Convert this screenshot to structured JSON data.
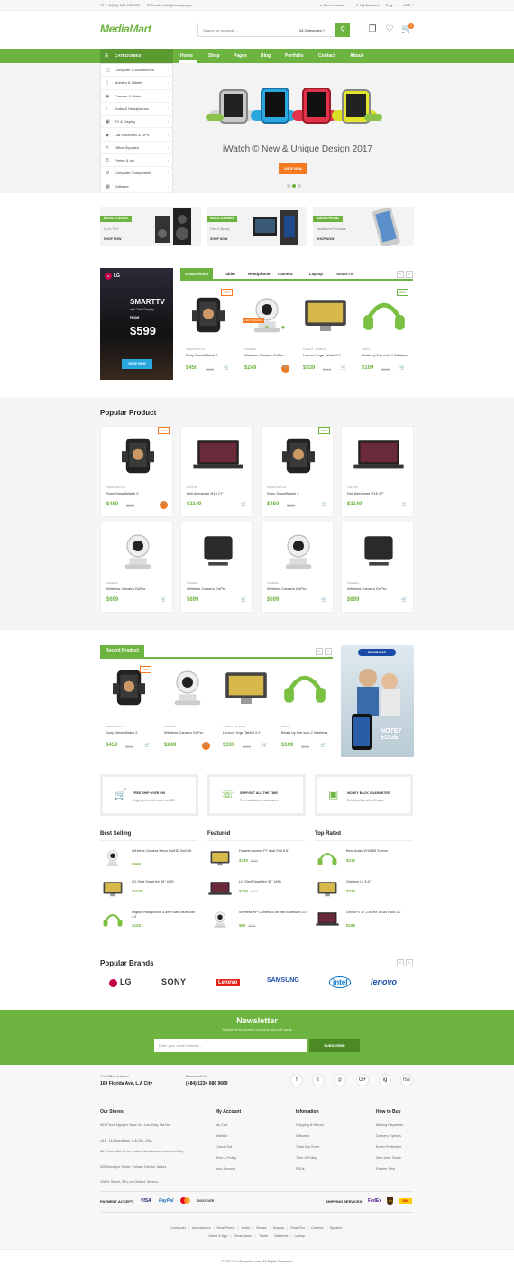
{
  "topbar": {
    "phone": "(+84)(0) 123 456 789",
    "email": "Email: hello@company.co",
    "store_locator": "Store Locator",
    "my_account": "My Account",
    "lang": "Eng",
    "currency": "USD"
  },
  "header": {
    "logo": "MediaMart",
    "search_placeholder": "Search for products ...",
    "search_category": "All Categories",
    "cart_count": "0"
  },
  "nav": {
    "categories_label": "CATEGORIES",
    "items": [
      "Home",
      "Shop",
      "Pages",
      "Blog",
      "Portfolio",
      "Contact",
      "About"
    ]
  },
  "categories": [
    "Computer & Accessories",
    "Mobiles & Tablets",
    "Camera & Video",
    "Audio & Headphones",
    "TV & Display",
    "Car Electronic & GPS",
    "Office Supplies",
    "Printer & Ink",
    "Computer Components",
    "Software"
  ],
  "hero": {
    "title": "iWatch © New & Unique Design 2017",
    "button": "SHOP NOW"
  },
  "banners": [
    {
      "tag": "MUSIC & AUDIO",
      "line": "Up to 70%",
      "link": "SHOP NOW"
    },
    {
      "tag": "BUILD GAMING",
      "line": "Fast & Strong",
      "link": "SHOP NOW"
    },
    {
      "tag": "SMARTPHONE",
      "line": "Installment Purchase",
      "link": "SHOP NOW"
    }
  ],
  "promo": {
    "brand": "LG",
    "title": "SMARTTV",
    "subtitle": "with Oled Display",
    "from": "FROM",
    "price": "$599",
    "button": "SHOP NOW"
  },
  "tabs": [
    "Smartphone",
    "Tablet",
    "Headphone",
    "Camera",
    "Laptop",
    "SmartTV"
  ],
  "tab_products": [
    {
      "type": "SMARTWATCH",
      "name": "Sony SmartWatch 2",
      "price": "$450",
      "old": "$550",
      "badge": "-40%"
    },
    {
      "type": "CAMERA",
      "name": "Wireless Camera GoPro",
      "price": "$249",
      "old": "",
      "badge": "",
      "hover": "Add to Wishlist"
    },
    {
      "type": "TABLET - MOBILE",
      "name": "Lenovo Yoga Tablet 2.0",
      "price": "$339",
      "old": "$419",
      "badge": ""
    },
    {
      "type": "AUDIO",
      "name": "Beats by Dre solo 2 Wireless",
      "price": "$109",
      "old": "$280",
      "badge": "NEW"
    }
  ],
  "popular": {
    "title": "Popular Product",
    "items": [
      {
        "type": "SMARTWATCH",
        "name": "Sony SmartWatch 2",
        "price": "$450",
        "old": "$550",
        "badge": "-40%"
      },
      {
        "type": "LAPTOP",
        "name": "Dell Alienware R15 17\"",
        "price": "$1149",
        "old": "",
        "badge": ""
      },
      {
        "type": "SMARTWATCH",
        "name": "Sony SmartWatch 2",
        "price": "$450",
        "old": "$550",
        "badge": "NEW"
      },
      {
        "type": "LAPTOP",
        "name": "Dell Alienware R15 17\"",
        "price": "$1149",
        "old": "",
        "badge": ""
      },
      {
        "type": "CAMERA",
        "name": "Wireless Camera GoPro",
        "price": "$699",
        "old": "",
        "badge": ""
      },
      {
        "type": "CAMERA",
        "name": "Wireless Camera GoPro",
        "price": "$699",
        "old": "",
        "badge": ""
      },
      {
        "type": "CAMERA",
        "name": "Wireless Camera GoPro",
        "price": "$699",
        "old": "",
        "badge": ""
      },
      {
        "type": "CAMERA",
        "name": "Wireless Camera GoPro",
        "price": "$699",
        "old": "",
        "badge": ""
      }
    ]
  },
  "recent": {
    "title": "Recent Product",
    "items": [
      {
        "type": "SMARTWATCH",
        "name": "Sony SmartWatch 2",
        "price": "$450",
        "old": "$550",
        "badge": "-40%"
      },
      {
        "type": "CAMERA",
        "name": "Wireless Camera GoPro",
        "price": "$249",
        "old": "",
        "badge": ""
      },
      {
        "type": "TABLET - MOBILE",
        "name": "Lenovo Yoga Tablet 2.0",
        "price": "$339",
        "old": "$419",
        "badge": ""
      },
      {
        "type": "AUDIO",
        "name": "Beats by Dre solo 2 Wireless",
        "price": "$109",
        "old": "$280",
        "badge": ""
      }
    ],
    "ad_brand": "SAMSUNG",
    "ad_text": "NOTE7 EDGE"
  },
  "services": [
    {
      "title": "FREE SHIP OVER $99",
      "sub": "Shipping free with order over $99"
    },
    {
      "title": "SUPPORT ALL THE TIME",
      "sub": "Free installation, maintenance"
    },
    {
      "title": "MONEY BACK GUARANTEE",
      "sub": "Refund policy within 30 days"
    }
  ],
  "lists": [
    {
      "title": "Best Selling",
      "items": [
        {
          "name": "Wireless Camera Xiono FullHD 3m/10ft",
          "price": "$565",
          "old": ""
        },
        {
          "name": "LG Oled Smart tivi 55\" UHD",
          "price": "$1149",
          "old": ""
        },
        {
          "name": "Orginal Headphone 3.5mm with bluetooth 3.0",
          "price": "$125",
          "old": ""
        }
      ]
    },
    {
      "title": "Featured",
      "items": [
        {
          "name": "Huawei Ascend P7 dual SIM 5.5\"",
          "price": "$330",
          "old": "$430"
        },
        {
          "name": "LG Oled Smart tivi 55\" UHD",
          "price": "$426",
          "old": "$699"
        },
        {
          "name": "Wireless HP Camera 3.5ft with bluetooth 3.0",
          "price": "$90",
          "old": "$120"
        }
      ]
    },
    {
      "title": "Top Rated",
      "items": [
        {
          "name": "Beat Audio VH4855 3.5mm",
          "price": "$210",
          "old": ""
        },
        {
          "name": "Optimus L5 5.5\"",
          "price": "$370",
          "old": ""
        },
        {
          "name": "Dell SFX 17 2.4GHz 16GB RAM 14\"",
          "price": "$199",
          "old": ""
        }
      ]
    }
  ],
  "brands": {
    "title": "Popular Brands",
    "items": [
      "LG",
      "SONY",
      "Lenovo",
      "SAMSUNG",
      "intel",
      "lenovo"
    ]
  },
  "newsletter": {
    "title": "Newsletter",
    "sub": "Subscribe to receive coupons and gift cards",
    "placeholder": "Enter your email address ...",
    "button": "SUBSCRIBE"
  },
  "footer": {
    "office_label": "Our Office Address",
    "office": "169 Florida Ave, L.A City",
    "call_label": "Please call Us",
    "phone": "(+84) 1234 686 9669",
    "socials": [
      "f",
      "t",
      "p",
      "G+",
      "ig",
      "rss"
    ],
    "cols": [
      {
        "title": "Our Stores",
        "items": [
          "601 Floor, Nguyen Ngoc Vu, Cau Giay, Ha Noi",
          "141 - 114 Sandiago, L.A City, USA",
          "5th Floor, 169 Green Lakes, Westbrown, Liverpool City",
          "628 Brooklyn Street, Fulham District, Wales",
          "10801 Street, Wil-Low District, Mexico."
        ]
      },
      {
        "title": "My Account",
        "items": [
          "My Cart",
          "Wishlist",
          "Check Out",
          "Term & Policy",
          "Your Account"
        ]
      },
      {
        "title": "Infomation",
        "items": [
          "Shipping & Return",
          "Giftcards",
          "Track My Order",
          "Term & Policy",
          "FAQs"
        ]
      },
      {
        "title": "How to Buy",
        "items": [
          "Making Payments",
          "Delivery Options",
          "Buyer Protection",
          "New User Guide",
          "Partner Ship"
        ]
      }
    ],
    "payment_label": "PAYMENT ACCEPT",
    "payments": [
      "VISA",
      "PayPal",
      "mc",
      "DISCOVER"
    ],
    "shipping_label": "SHIPPING SERVICES",
    "shippers": [
      "FedEx",
      "UPS",
      "DHL"
    ],
    "tags_row1": [
      "Computer",
      "Accessories",
      "HeadPhone",
      "Audio",
      "Mouse",
      "Display",
      "SmartTivi",
      "Camera",
      "Speaker"
    ],
    "tags_row2": [
      "Game & App",
      "Smartphone",
      "Tablet",
      "Batteries",
      "Laptop"
    ],
    "copyright": "© 2017 ZooTemplate.com. All Rights Reserved"
  }
}
